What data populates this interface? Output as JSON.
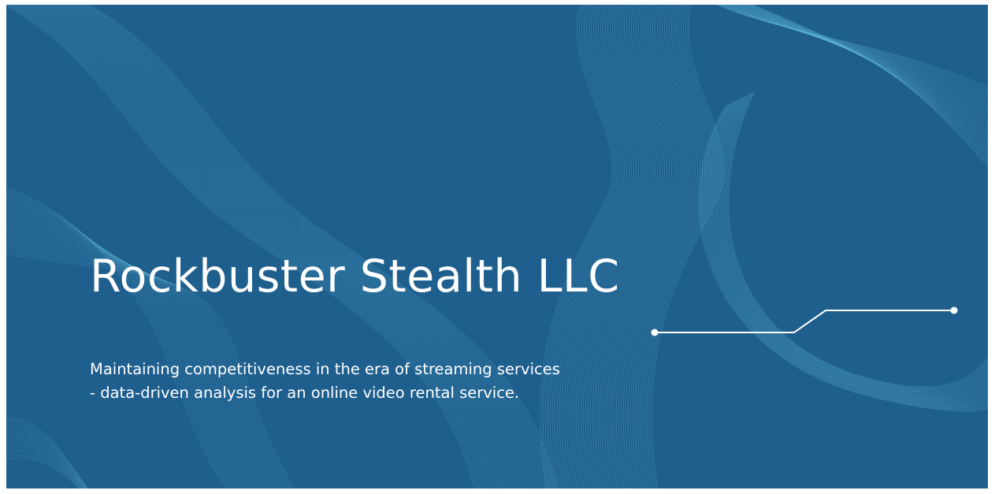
{
  "slide": {
    "title": "Rockbuster Stealth LLC",
    "subtitle_line1": "Maintaining competitiveness in the era of streaming services",
    "subtitle_line2": "- data-driven analysis for an online video rental service."
  },
  "theme": {
    "background": "#1f5f8e",
    "line_color": "#5fb8d6",
    "text_color": "#ffffff"
  }
}
